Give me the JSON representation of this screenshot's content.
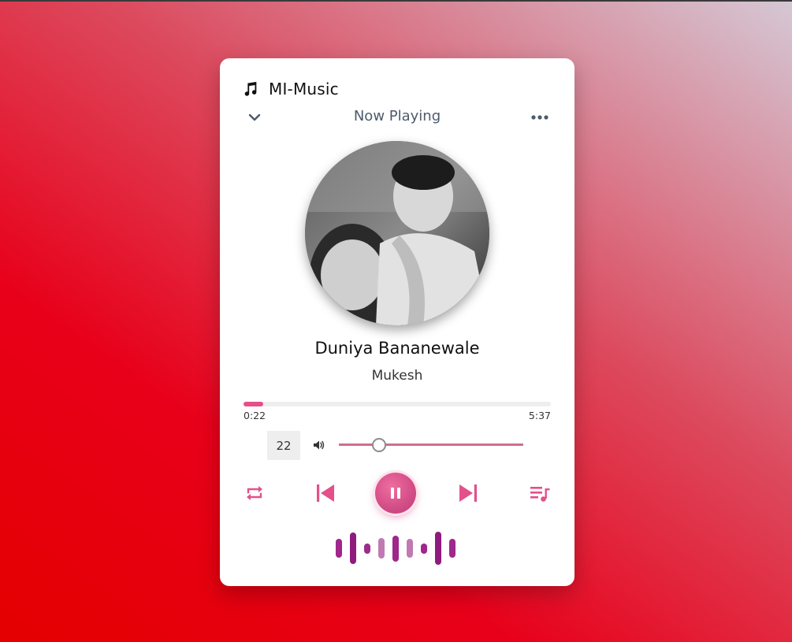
{
  "app": {
    "name": "MI-Music",
    "music_icon": "music-note-icon"
  },
  "nav": {
    "title": "Now Playing",
    "collapse_icon": "chevron-down-icon",
    "more_icon": "more-horizontal-icon"
  },
  "track": {
    "title": "Duniya Bananewale",
    "artist": "Mukesh",
    "cover_icon": "album-art"
  },
  "playback": {
    "current_time": "0:22",
    "duration": "5:37",
    "progress_fraction": 0.065
  },
  "volume": {
    "value": "22",
    "level_fraction": 0.22,
    "icon": "volume-icon"
  },
  "controls": {
    "repeat_icon": "repeat-icon",
    "previous_icon": "skip-previous-icon",
    "play_pause_icon": "pause-icon",
    "next_icon": "skip-next-icon",
    "queue_icon": "playlist-icon"
  },
  "visualizer": {
    "levels": [
      0.55,
      0.9,
      0.3,
      0.6,
      0.75,
      0.55,
      0.3,
      0.95,
      0.55
    ],
    "colors": [
      "#a0278b",
      "#8f1b7f",
      "#9c2d8a",
      "#c07ab1",
      "#a0278b",
      "#c07ab1",
      "#a0278b",
      "#8f1b7f",
      "#a0278b"
    ]
  },
  "colors": {
    "accent": "#e3508a",
    "accent_dark": "#c73c78",
    "text_muted": "#4d5b6c"
  }
}
